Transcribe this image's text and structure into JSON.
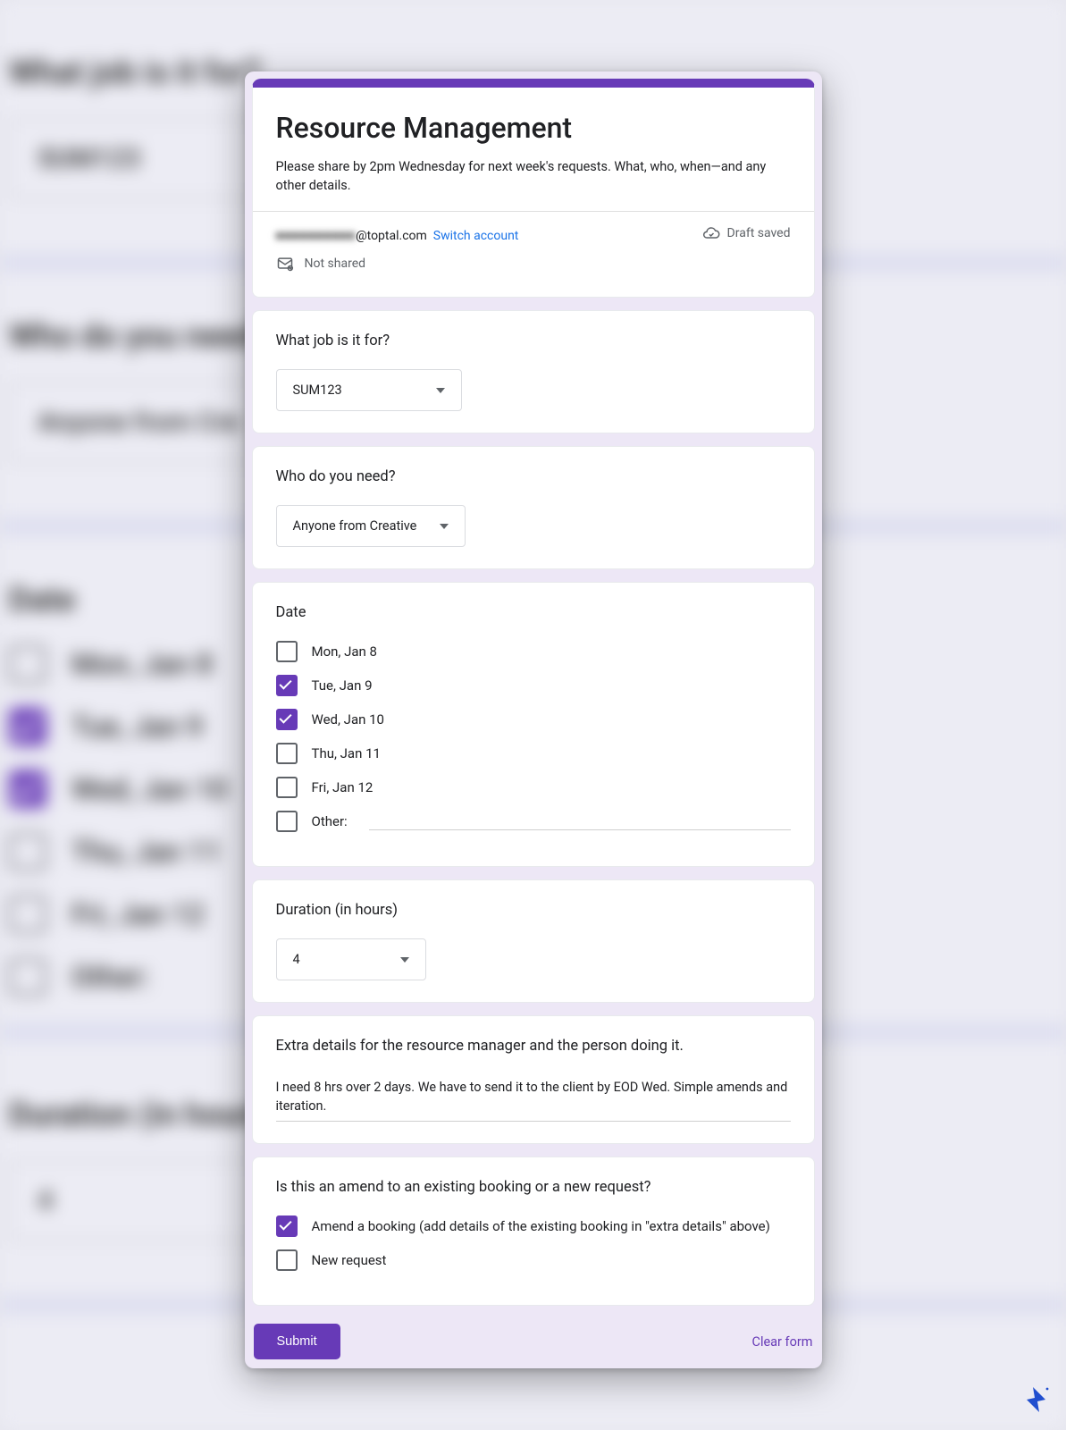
{
  "header": {
    "title": "Resource Management",
    "description": "Please share by 2pm Wednesday for next week's requests. What, who, when—and any other details.",
    "email_hidden": "■■■■■■■■■■",
    "email_domain": "@toptal.com",
    "switch_account": "Switch account",
    "draft_saved": "Draft saved",
    "not_shared": "Not shared"
  },
  "q_job": {
    "label": "What job is it for?",
    "value": "SUM123"
  },
  "q_who": {
    "label": "Who do you need?",
    "value": "Anyone from Creative"
  },
  "q_date": {
    "label": "Date",
    "options": [
      {
        "label": "Mon, Jan 8",
        "checked": false
      },
      {
        "label": "Tue, Jan 9",
        "checked": true
      },
      {
        "label": "Wed, Jan 10",
        "checked": true
      },
      {
        "label": "Thu, Jan 11",
        "checked": false
      },
      {
        "label": "Fri, Jan 12",
        "checked": false
      }
    ],
    "other_label": "Other:"
  },
  "q_duration": {
    "label": "Duration (in hours)",
    "value": "4"
  },
  "q_details": {
    "label": "Extra details for the resource manager and the person doing it.",
    "value": "I need 8 hrs over 2 days. We have to send it to the client by EOD Wed. Simple amends and iteration."
  },
  "q_amend": {
    "label": "Is this an amend to an existing booking or a new request?",
    "options": [
      {
        "label": "Amend a booking (add details of the existing booking in \"extra details\" above)",
        "checked": true
      },
      {
        "label": "New request",
        "checked": false
      }
    ]
  },
  "actions": {
    "submit": "Submit",
    "clear": "Clear form"
  },
  "background": {
    "q1": "What job is it for?",
    "v1": "SUM123",
    "q2": "Who do you need?",
    "v2": "Anyone from Cre",
    "q3": "Date",
    "d": [
      "Mon, Jan 8",
      "Tue, Jan 9",
      "Wed, Jan 10",
      "Thu, Jan 11",
      "Fri, Jan 12",
      "Other:"
    ],
    "q4": "Duration (in hours)",
    "v4": "4"
  }
}
